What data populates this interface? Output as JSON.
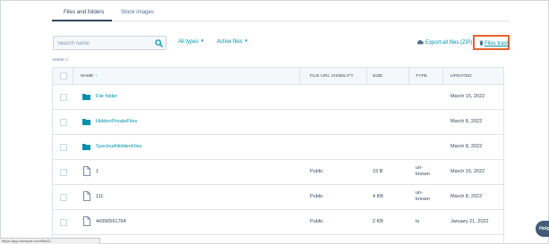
{
  "tabs": [
    {
      "label": "Files and folders",
      "active": true
    },
    {
      "label": "Stock images",
      "active": false
    }
  ],
  "toolbar": {
    "search_placeholder": "Search name",
    "filter_types": "All types",
    "filter_files": "Active files",
    "export_label": "Export all files (ZIP)",
    "trash_label": "Files trash"
  },
  "breadcrumb": "Home",
  "breadcrumb_sep": ">",
  "table": {
    "columns": [
      "NAME",
      "FILE URL VISIBILITY",
      "SIZE",
      "TYPE",
      "UPDATED"
    ],
    "sort_indicator": "↑",
    "rows": [
      {
        "kind": "folder",
        "name": "File folder",
        "visibility": "",
        "size": "",
        "type": "",
        "updated": "March 15, 2022"
      },
      {
        "kind": "folder",
        "name": "HiddenPrivateFiles",
        "visibility": "",
        "size": "",
        "type": "",
        "updated": "March 8, 2022"
      },
      {
        "kind": "folder",
        "name": "SyscloudHiddenFiles",
        "visibility": "",
        "size": "",
        "type": "",
        "updated": "March 8, 2022"
      },
      {
        "kind": "file",
        "name": "1",
        "visibility": "Public",
        "size": "19 B",
        "type": "un-known",
        "updated": "March 15, 2022"
      },
      {
        "kind": "file",
        "name": "111",
        "visibility": "Public",
        "size": "4 KB",
        "type": "un-known",
        "updated": "March 8, 2022"
      },
      {
        "kind": "file",
        "name": "44390561764",
        "visibility": "Public",
        "size": "2 KB",
        "type": "ts",
        "updated": "January 21, 2022"
      }
    ]
  },
  "status_url": "https://app.hubspot.com/files/2...",
  "help_label": "Help",
  "colors": {
    "accent": "#0091ae",
    "highlight": "#e8632d",
    "text": "#33475b"
  }
}
